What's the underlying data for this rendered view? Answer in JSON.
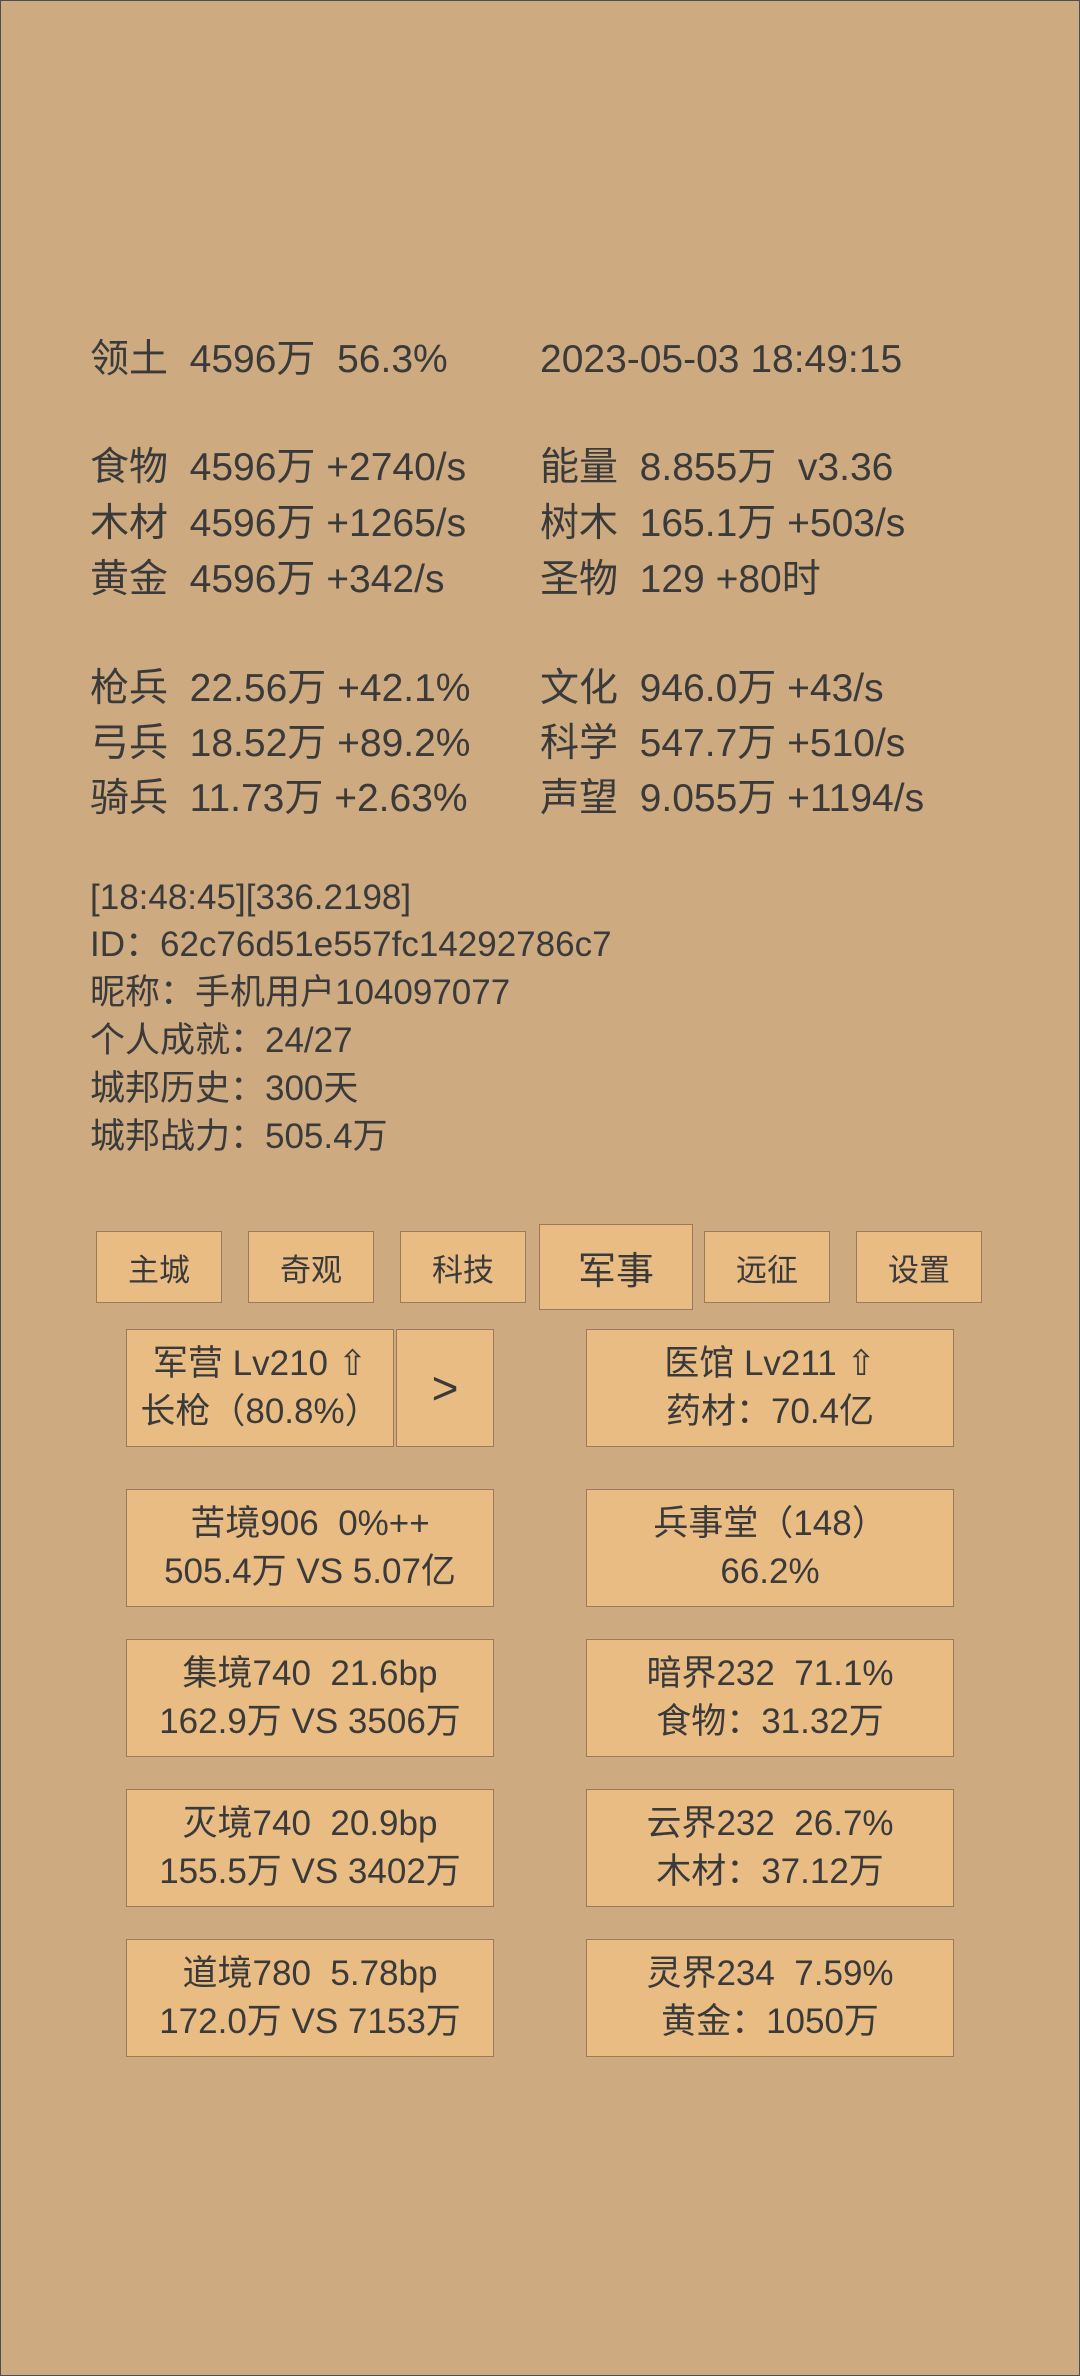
{
  "header": {
    "territory": "领土  4596万  56.3%",
    "datetime": "2023-05-03 18:49:15"
  },
  "resources": {
    "food": "食物  4596万 +2740/s",
    "wood": "木材  4596万 +1265/s",
    "gold": "黄金  4596万 +342/s",
    "energy": "能量  8.855万  v3.36",
    "trees": "树木  165.1万 +503/s",
    "relics": "圣物  129 +80时"
  },
  "troops": {
    "spear": "枪兵  22.56万 +42.1%",
    "archer": "弓兵  18.52万 +89.2%",
    "cavalry": "骑兵  11.73万 +2.63%",
    "culture": "文化  946.0万 +43/s",
    "science": "科学  547.7万 +510/s",
    "prestige": "声望  9.055万 +1194/s"
  },
  "info": {
    "timestamp": "[18:48:45][336.2198]",
    "id": "ID：62c76d51e557fc14292786c7",
    "nickname": "昵称：手机用户104097077",
    "achievements": "个人成就：24/27",
    "history": "城邦历史：300天",
    "power": "城邦战力：505.4万"
  },
  "tabs": [
    {
      "label": "主城"
    },
    {
      "label": "奇观"
    },
    {
      "label": "科技"
    },
    {
      "label": "军事"
    },
    {
      "label": "远征"
    },
    {
      "label": "设置"
    }
  ],
  "active_tab": "军事",
  "cards": {
    "barracks": {
      "line1": "军营 Lv210 ⇧",
      "line2": "长枪（80.8%）"
    },
    "barracks_next": {
      "label": ">"
    },
    "hospital": {
      "line1": "医馆 Lv211 ⇧",
      "line2": "药材：70.4亿"
    },
    "kujing": {
      "line1": "苦境906  0%++",
      "line2": "505.4万 VS 5.07亿"
    },
    "bingshitang": {
      "line1": "兵事堂（148）",
      "line2": "66.2%"
    },
    "jijing": {
      "line1": "集境740  21.6bp",
      "line2": "162.9万 VS 3506万"
    },
    "anjie": {
      "line1": "暗界232  71.1%",
      "line2": "食物：31.32万"
    },
    "miejing": {
      "line1": "灭境740  20.9bp",
      "line2": "155.5万 VS 3402万"
    },
    "yunjie": {
      "line1": "云界232  26.7%",
      "line2": "木材：37.12万"
    },
    "daojing": {
      "line1": "道境780  5.78bp",
      "line2": "172.0万 VS 7153万"
    },
    "lingjie": {
      "line1": "灵界234  7.59%",
      "line2": "黄金：1050万"
    }
  },
  "colors": {
    "background": "#cdaa80",
    "button": "#e9bc84",
    "border": "#9a7a5a",
    "text": "#3a3a3a"
  }
}
